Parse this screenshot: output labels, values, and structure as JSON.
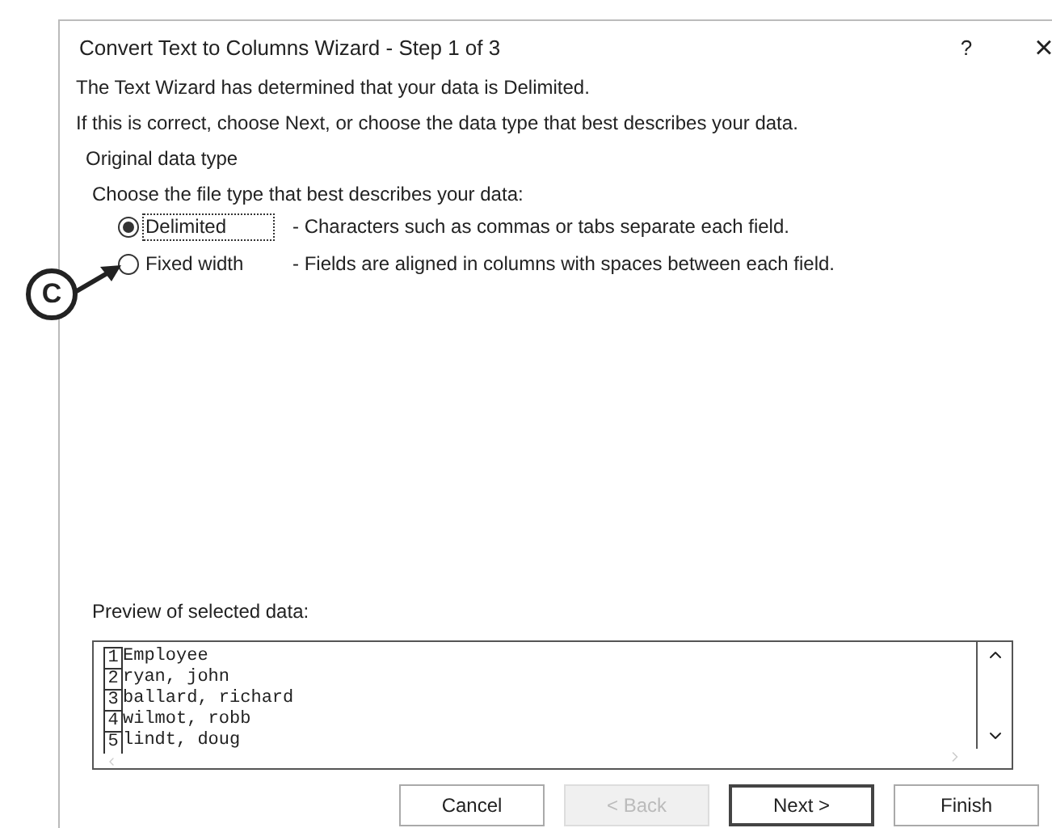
{
  "window": {
    "title": "Convert Text to Columns Wizard - Step 1 of 3",
    "help": "?",
    "close": "×"
  },
  "messages": [
    "The Text Wizard has determined that your data is Delimited.",
    "If this is correct, choose Next, or choose the data type that best describes your data."
  ],
  "group": {
    "title": "Original data type",
    "prompt": "Choose the file type that best describes your data:",
    "options": [
      {
        "label": "Delimited",
        "description": "- Characters such as commas or tabs separate each field.",
        "selected": true
      },
      {
        "label": "Fixed width",
        "description": "- Fields are aligned in columns with spaces between each field.",
        "selected": false
      }
    ]
  },
  "callout": "C",
  "preview": {
    "label": "Preview of selected data:",
    "rows": [
      {
        "number": "1",
        "text": "Employee"
      },
      {
        "number": "2",
        "text": "ryan, john"
      },
      {
        "number": "3",
        "text": "ballard, richard"
      },
      {
        "number": "4",
        "text": "wilmot, robb"
      },
      {
        "number": "5",
        "text": "lindt, doug"
      }
    ]
  },
  "buttons": [
    {
      "label": "Cancel",
      "disabled": false,
      "default": false
    },
    {
      "label": "< Back",
      "disabled": true,
      "default": false
    },
    {
      "label": "Next >",
      "disabled": false,
      "default": true
    },
    {
      "label": "Finish",
      "disabled": false,
      "default": false
    }
  ]
}
